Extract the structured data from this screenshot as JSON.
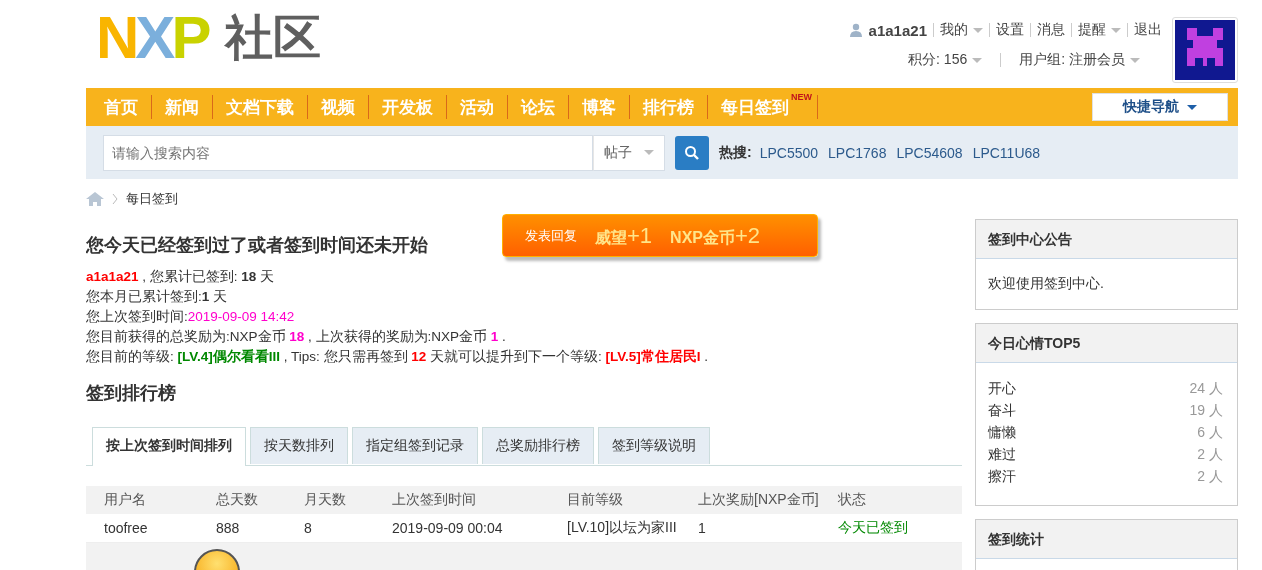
{
  "logo": {
    "letters": [
      "N",
      "X",
      "P"
    ],
    "text": "社区"
  },
  "user_bar": {
    "username": "a1a1a21",
    "links": [
      {
        "label": "我的",
        "dropdown": true
      },
      {
        "label": "设置",
        "dropdown": false
      },
      {
        "label": "消息",
        "dropdown": false
      },
      {
        "label": "提醒",
        "dropdown": true
      },
      {
        "label": "退出",
        "dropdown": false
      }
    ],
    "credits": "积分: 156",
    "group": "用户组: 注册会员"
  },
  "nav": {
    "items": [
      {
        "label": "首页",
        "selected": false
      },
      {
        "label": "新闻",
        "selected": false
      },
      {
        "label": "文档下载",
        "selected": false
      },
      {
        "label": "视频",
        "selected": false
      },
      {
        "label": "开发板",
        "selected": false
      },
      {
        "label": "活动",
        "selected": false
      },
      {
        "label": "论坛",
        "selected": false
      },
      {
        "label": "博客",
        "selected": false
      },
      {
        "label": "排行榜",
        "selected": false
      },
      {
        "label": "每日签到",
        "selected": false,
        "badge": "NEW"
      }
    ],
    "quick_nav": "快捷导航"
  },
  "search": {
    "placeholder": "请输入搜索内容",
    "scope": "帖子",
    "hot_label": "热搜:",
    "hot": [
      "LPC5500",
      "LPC1768",
      "LPC54608",
      "LPC11U68"
    ]
  },
  "breadcrumb": "每日签到",
  "popup": {
    "label": "发表回复",
    "rewards": [
      {
        "name": "威望",
        "value": "+1"
      },
      {
        "name": "NXP金币",
        "value": "+2"
      }
    ]
  },
  "status_title": "您今天已经签到过了或者签到时间还未开始",
  "stat_lines": [
    [
      {
        "kind": "red",
        "text": "a1a1a21"
      },
      {
        "kind": "plain",
        "text": " , 您累计已签到: "
      },
      {
        "kind": "bold",
        "text": "18"
      },
      {
        "kind": "plain",
        "text": " 天"
      }
    ],
    [
      {
        "kind": "plain",
        "text": "您本月已累计签到:"
      },
      {
        "kind": "bold",
        "text": "1"
      },
      {
        "kind": "plain",
        "text": " 天"
      }
    ],
    [
      {
        "kind": "plain",
        "text": "您上次签到时间:"
      },
      {
        "kind": "magenta",
        "text": "2019-09-09 14:42"
      }
    ],
    [
      {
        "kind": "plain",
        "text": "您目前获得的总奖励为:NXP金币 "
      },
      {
        "kind": "magenta-bold",
        "text": "18"
      },
      {
        "kind": "plain",
        "text": " , 上次获得的奖励为:NXP金币 "
      },
      {
        "kind": "magenta-bold",
        "text": "1"
      },
      {
        "kind": "plain",
        "text": " ."
      }
    ],
    [
      {
        "kind": "plain",
        "text": "您目前的等级: "
      },
      {
        "kind": "green",
        "text": "[LV.4]偶尔看看III"
      },
      {
        "kind": "plain",
        "text": " , Tips: 您只需再签到 "
      },
      {
        "kind": "red",
        "text": "12"
      },
      {
        "kind": "plain",
        "text": " 天就可以提升到下一个等级: "
      },
      {
        "kind": "red",
        "text": "[LV.5]常住居民I"
      },
      {
        "kind": "plain",
        "text": " ."
      }
    ]
  ],
  "ranking": {
    "title": "签到排行榜",
    "tabs": [
      {
        "label": "按上次签到时间排列",
        "selected": true
      },
      {
        "label": "按天数排列",
        "selected": false
      },
      {
        "label": "指定组签到记录",
        "selected": false
      },
      {
        "label": "总奖励排行榜",
        "selected": false
      },
      {
        "label": "签到等级说明",
        "selected": false
      }
    ],
    "columns": [
      "用户名",
      "总天数",
      "月天数",
      "上次签到时间",
      "目前等级",
      "上次奖励[NXP金币]",
      "状态"
    ],
    "rows": [
      [
        "toofree",
        "888",
        "8",
        "2019-09-09 00:04",
        "[LV.10]以坛为家III",
        "1",
        "今天已签到"
      ]
    ]
  },
  "sidebar": {
    "notice": {
      "title": "签到中心公告",
      "text": "欢迎使用签到中心."
    },
    "mood": {
      "title": "今日心情TOP5",
      "items": [
        {
          "name": "开心",
          "count": "24 人"
        },
        {
          "name": "奋斗",
          "count": "19 人"
        },
        {
          "name": "慵懒",
          "count": "6 人"
        },
        {
          "name": "难过",
          "count": "2 人"
        },
        {
          "name": "擦汗",
          "count": "2 人"
        }
      ]
    },
    "stats": {
      "title": "签到统计"
    }
  }
}
